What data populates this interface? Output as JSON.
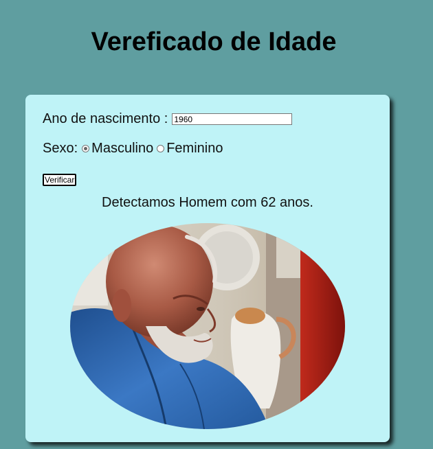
{
  "page": {
    "title": "Vereficado de Idade"
  },
  "form": {
    "birth_year_label": "Ano de nascimento :",
    "birth_year_value": "1960",
    "sex_label": "Sexo:",
    "sex_options": [
      "Masculino",
      "Feminino"
    ],
    "sex_selected": "Masculino",
    "verify_button": "Verificar"
  },
  "result": {
    "text": "Detectamos Homem com 62 anos.",
    "image": "photo of elderly man with white beard in blue shirt"
  },
  "colors": {
    "background": "#5f9ea0",
    "card": "#bff3f7"
  }
}
